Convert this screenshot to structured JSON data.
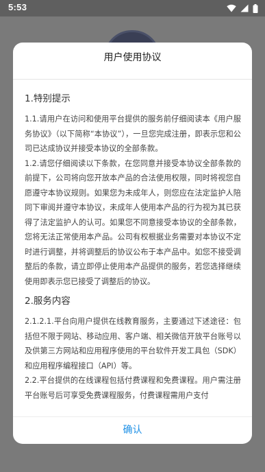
{
  "status_bar": {
    "time": "5:53",
    "icons": [
      "wifi-icon",
      "cellular-signal-icon",
      "battery-icon"
    ]
  },
  "dialog": {
    "title": "用户使用协议",
    "sections": [
      {
        "heading": "1.特别提示",
        "paragraphs": [
          "1.1.请用户在访问和使用平台提供的服务前仔细阅读本《用户服务协议》（以下简称“本协议”），一旦您完成注册，即表示您和公司已达成协议并接受本协议的全部条款。",
          "1.2.请您仔细阅读以下条款，在您同意并接受本协议全部条款的前提下，公司将向您开放本产品的合法使用权限，同时将视您自愿遵守本协议规则。如果您为未成年人，则您应在法定监护人陪同下审阅并遵守本协议，未成年人使用本产品的行为视为其已获得了法定监护人的认可。如果您不同意接受本协议的全部条款，您将无法正常使用本产品。公司有权根据业务需要对本协议不定时进行调整，并将调整后的协议公布于本产品中。如您不接受调整后的条款，请立即停止使用本产品提供的服务，若您选择继续使用即表示您已接受了调整后的协议。"
        ]
      },
      {
        "heading": "2.服务内容",
        "paragraphs": [
          "2.1.2.1.平台向用户提供在线教育服务，主要通过下述途径：包括但不限于网站、移动应用、客户端、相关微信开放平台账号以及供第三方网站和应用程序使用的平台软件开发工具包（SDK）和应用程序编程接口（API）等。",
          "2.2.平台提供的在线课程包括付费课程和免费课程。用户需注册平台账号后可享受免费课程服务，付费课程需用户支付"
        ]
      }
    ],
    "confirm_label": "确认"
  },
  "colors": {
    "accent": "#1e90e6",
    "scrim": "#7a7a7a",
    "status_bar": "#5f5f5f"
  }
}
